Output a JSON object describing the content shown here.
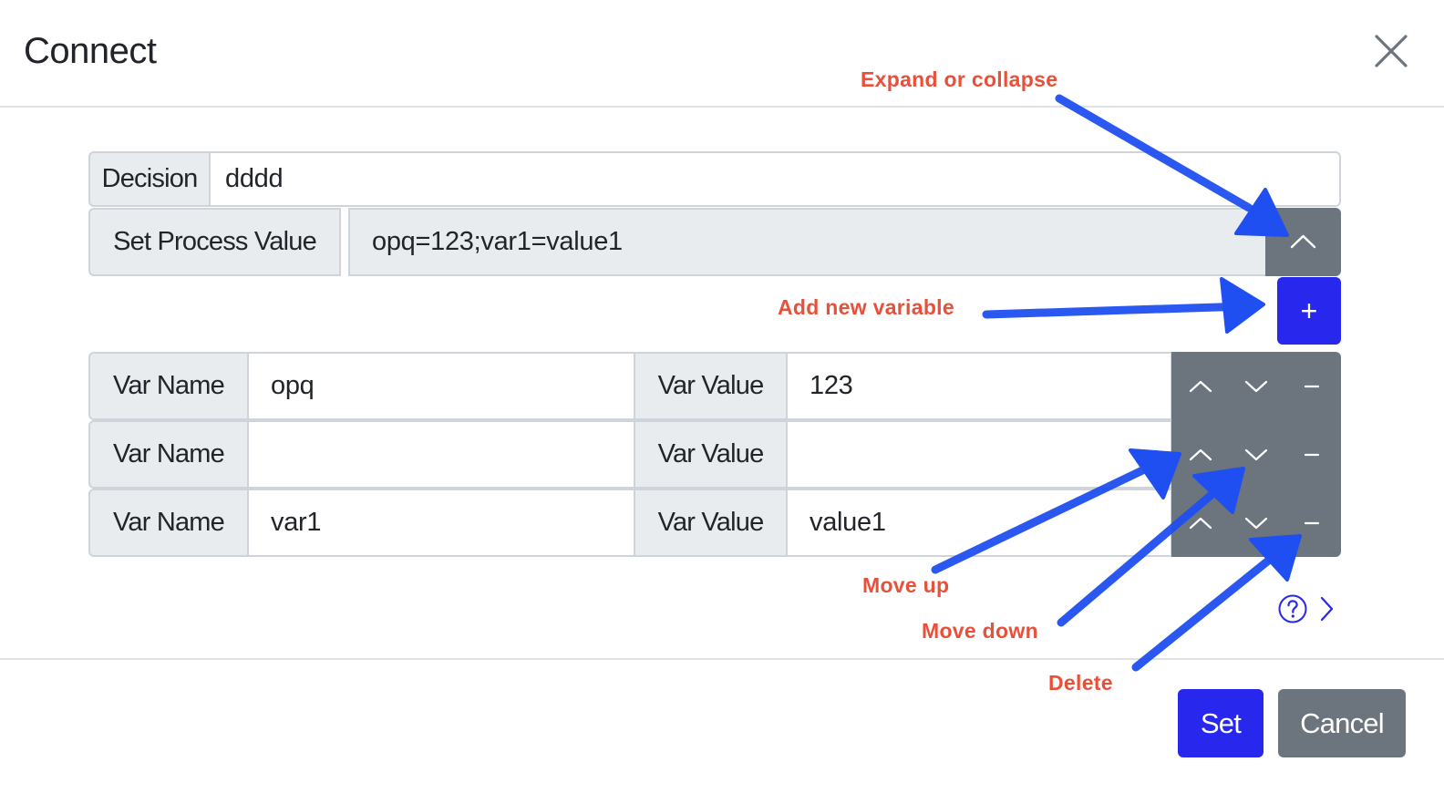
{
  "modal": {
    "title": "Connect",
    "close_icon": "close-icon"
  },
  "decision": {
    "label": "Decision",
    "value": "dddd"
  },
  "process_value": {
    "label": "Set Process Value",
    "value": "opq=123;var1=value1",
    "toggle_icon": "chevron-up-icon"
  },
  "add_button": {
    "label": "+"
  },
  "variables": [
    {
      "name_label": "Var Name",
      "name": "opq",
      "value_label": "Var Value",
      "value": "123"
    },
    {
      "name_label": "Var Name",
      "name": "",
      "value_label": "Var Value",
      "value": ""
    },
    {
      "name_label": "Var Name",
      "name": "var1",
      "value_label": "Var Value",
      "value": "value1"
    }
  ],
  "row_actions": [
    "move-up-icon",
    "move-down-icon",
    "delete-icon"
  ],
  "help": {
    "icons": [
      "help-icon",
      "chevron-right-icon"
    ]
  },
  "footer": {
    "set_label": "Set",
    "cancel_label": "Cancel"
  },
  "annotations": {
    "expand": "Expand or collapse",
    "add": "Add new variable",
    "move_up": "Move up",
    "move_down": "Move down",
    "delete": "Delete"
  },
  "colors": {
    "primary": "#2727ee",
    "secondary": "#6c757d",
    "annotation_text": "#e8503a",
    "annotation_arrow": "#1f4ff0"
  }
}
